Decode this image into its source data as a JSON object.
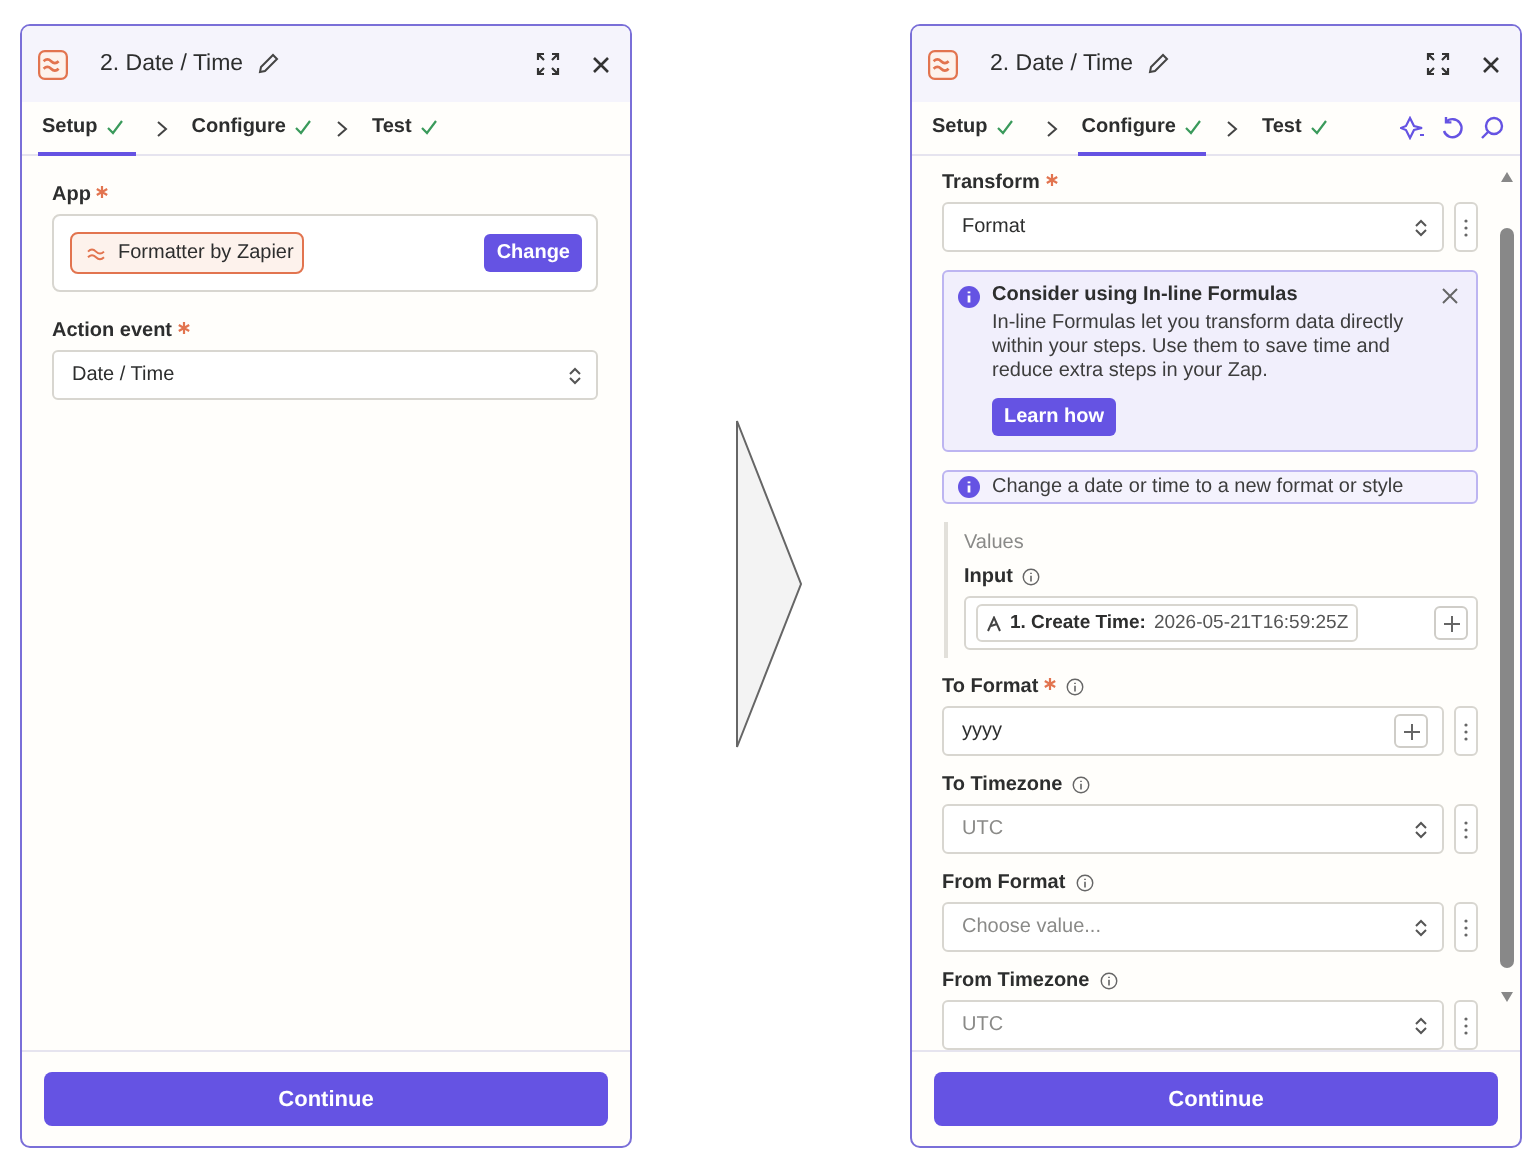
{
  "panels": [
    {
      "title": "2. Date / Time",
      "toolbar": false,
      "scrollbar": false,
      "tabs": [
        {
          "label": "Setup",
          "selected": true,
          "done": true
        },
        {
          "label": "Configure",
          "selected": false,
          "done": true
        },
        {
          "label": "Test",
          "selected": false,
          "done": true
        }
      ],
      "fields": [
        {
          "kind": "app",
          "label": "App",
          "required": true,
          "app": "Formatter by Zapier",
          "button": "Change"
        },
        {
          "kind": "select",
          "label": "Action event",
          "required": true,
          "info": false,
          "menu": false,
          "value": "Date / Time"
        }
      ],
      "continue": "Continue"
    },
    {
      "title": "2. Date / Time",
      "toolbar": true,
      "scrollbar": true,
      "tabs": [
        {
          "label": "Setup",
          "selected": false,
          "done": true
        },
        {
          "label": "Configure",
          "selected": true,
          "done": true
        },
        {
          "label": "Test",
          "selected": false,
          "done": true
        }
      ],
      "fields": [
        {
          "kind": "select",
          "label": "Transform",
          "required": true,
          "info": false,
          "menu": true,
          "value": "Format"
        },
        {
          "kind": "callout",
          "title": "Consider using In-line Formulas",
          "body": "In-line Formulas let you transform data directly within your steps. Use them to save time and reduce extra steps in your Zap.",
          "button": "Learn how",
          "dismissible": true
        },
        {
          "kind": "note",
          "text": "Change a date or time to a new format or style"
        },
        {
          "kind": "group",
          "title": "Values",
          "children": [
            {
              "kind": "token",
              "label": "Input",
              "required": false,
              "info": true,
              "menu": false,
              "token_label": "1. Create Time:",
              "token_value": "2026-05-21T16:59:25Z"
            }
          ]
        },
        {
          "kind": "text",
          "label": "To Format",
          "required": true,
          "info": true,
          "menu": true,
          "value": "yyyy"
        },
        {
          "kind": "select",
          "label": "To Timezone",
          "required": false,
          "info": true,
          "menu": true,
          "placeholder": "UTC"
        },
        {
          "kind": "select",
          "label": "From Format",
          "required": false,
          "info": true,
          "menu": true,
          "placeholder": "Choose value..."
        },
        {
          "kind": "select",
          "label": "From Timezone",
          "required": false,
          "info": true,
          "menu": true,
          "placeholder": "UTC"
        }
      ],
      "continue": "Continue"
    }
  ]
}
